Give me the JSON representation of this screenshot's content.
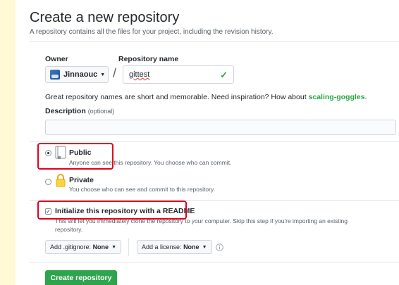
{
  "header": {
    "title": "Create a new repository",
    "subtitle": "A repository contains all the files for your project, including the revision history."
  },
  "owner": {
    "label": "Owner",
    "value": "Jinnaouc",
    "avatar_icon": "avatar-icon"
  },
  "repo": {
    "label": "Repository name",
    "value": "gittest",
    "separator": "/"
  },
  "hint": {
    "text": "Great repository names are short and memorable. Need inspiration? How about ",
    "suggestion": "scaling-goggles",
    "end": "."
  },
  "description": {
    "label": "Description",
    "optional": "(optional)",
    "value": ""
  },
  "visibility": {
    "public": {
      "title": "Public",
      "note": "Anyone can see this repository. You choose who can commit.",
      "selected": true
    },
    "private": {
      "title": "Private",
      "note": "You choose who can see and commit to this repository.",
      "selected": false
    }
  },
  "init": {
    "checked": true,
    "title": "Initialize this repository with a README",
    "note_line1": "This will let you immediately clone the repository to your computer. Skip this step if you're importing an existing",
    "note_line2": "repository."
  },
  "selects": {
    "gitignore_prefix": "Add .gitignore: ",
    "gitignore_value": "None",
    "license_prefix": "Add a license: ",
    "license_value": "None"
  },
  "submit": {
    "label": "Create repository"
  },
  "colors": {
    "accent_green": "#2ea44f",
    "highlight_red": "#e3001b",
    "background": "#fff9d6"
  }
}
